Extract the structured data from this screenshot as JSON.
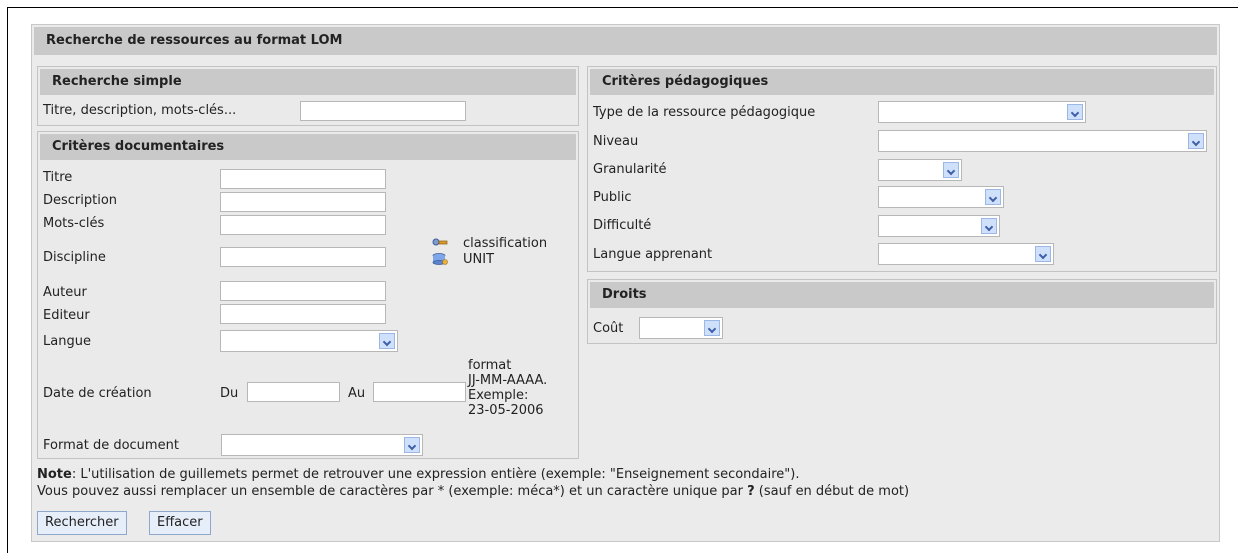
{
  "frame": {
    "title": "Recherche de ressources au format LOM"
  },
  "simple": {
    "heading": "Recherche simple",
    "label": "Titre, description, mots-clés...",
    "value": ""
  },
  "doc": {
    "heading": "Critères documentaires",
    "titre": "Titre",
    "description": "Description",
    "mots_cles": "Mots-clés",
    "discipline": "Discipline",
    "classification": "classification",
    "unit": "UNIT",
    "auteur": "Auteur",
    "editeur": "Editeur",
    "langue": "Langue",
    "date": "Date de création",
    "du": "Du",
    "au": "Au",
    "format_hint": [
      "format",
      "JJ-MM-AAAA.",
      "Exemple:",
      "23-05-2006"
    ],
    "format_doc": "Format de document"
  },
  "peda": {
    "heading": "Critères pédagogiques",
    "type": "Type de la ressource pédagogique",
    "niveau": "Niveau",
    "granularite": "Granularité",
    "public": "Public",
    "difficulte": "Difficulté",
    "langue_apprenant": "Langue apprenant"
  },
  "droits": {
    "heading": "Droits",
    "cout": "Coût"
  },
  "note": {
    "bold": "Note",
    "line1": ": L'utilisation de guillemets permet de retrouver une expression entière (exemple: \"Enseignement secondaire\").",
    "line2a": "Vous pouvez aussi remplacer un ensemble de caractères par * (exemple: méca*) et un caractère unique par ",
    "q": "?",
    "line2b": " (sauf en début de mot)"
  },
  "buttons": {
    "search": "Rechercher",
    "clear": "Effacer"
  },
  "icons": {
    "classification": "key-icon",
    "unit": "database-icon"
  }
}
